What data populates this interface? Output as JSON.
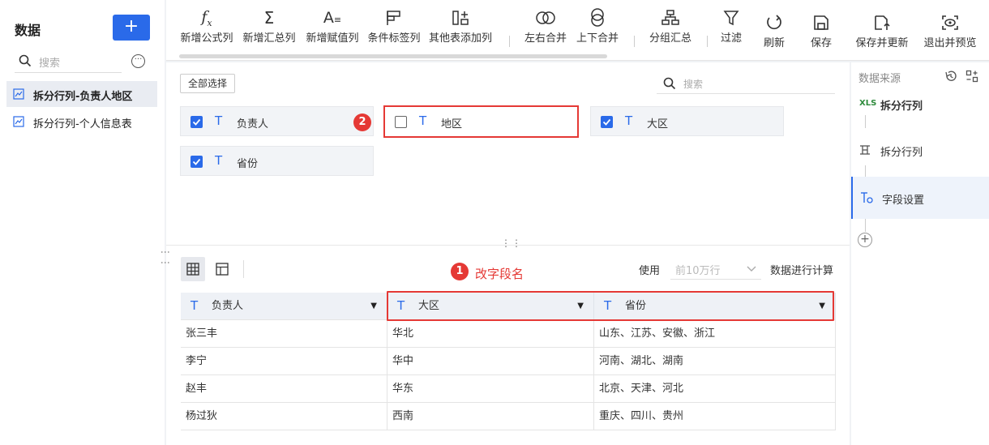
{
  "sidebar": {
    "title": "数据",
    "add_label": "+",
    "search_placeholder": "搜索",
    "tables": [
      {
        "label": "拆分行列-负责人地区",
        "active": true
      },
      {
        "label": "拆分行列-个人信息表",
        "active": false
      }
    ]
  },
  "toolbar": {
    "items": [
      {
        "label": "新增公式列",
        "icon": "formula-icon"
      },
      {
        "label": "新增汇总列",
        "icon": "sum-icon"
      },
      {
        "label": "新增赋值列",
        "icon": "assign-icon"
      },
      {
        "label": "条件标签列",
        "icon": "flag-icon"
      },
      {
        "label": "其他表添加列",
        "icon": "add-column-icon"
      },
      {
        "label": "左右合并",
        "icon": "merge-lr-icon"
      },
      {
        "label": "上下合并",
        "icon": "merge-tb-icon"
      },
      {
        "label": "分组汇总",
        "icon": "group-icon"
      },
      {
        "label": "过滤",
        "icon": "filter-icon"
      }
    ],
    "actions": [
      {
        "label": "刷新",
        "icon": "refresh-icon"
      },
      {
        "label": "保存",
        "icon": "save-icon"
      },
      {
        "label": "保存并更新",
        "icon": "save-update-icon"
      },
      {
        "label": "退出并预览",
        "icon": "preview-icon"
      }
    ]
  },
  "fields": {
    "select_all": "全部选择",
    "search_placeholder": "搜索",
    "items": [
      {
        "name": "负责人",
        "checked": true
      },
      {
        "name": "地区",
        "checked": false
      },
      {
        "name": "大区",
        "checked": true
      },
      {
        "name": "省份",
        "checked": true
      }
    ],
    "badge": "2",
    "type_glyph": "T"
  },
  "preview": {
    "annotation_badge": "1",
    "annotation": "改字段名",
    "use_label": "使用",
    "rows_option": "前10万行",
    "calc_label": "数据进行计算",
    "columns": [
      "负责人",
      "大区",
      "省份"
    ],
    "rows": [
      [
        "张三丰",
        "华北",
        "山东、江苏、安徽、浙江"
      ],
      [
        "李宁",
        "华中",
        "河南、湖北、湖南"
      ],
      [
        "赵丰",
        "华东",
        "北京、天津、河北"
      ],
      [
        "杨过狄",
        "西南",
        "重庆、四川、贵州"
      ]
    ]
  },
  "steps_panel": {
    "title": "数据来源",
    "steps": [
      {
        "label": "拆分行列",
        "icon": "xls-icon",
        "badge_text": "XLS"
      },
      {
        "label": "拆分行列",
        "icon": "split-icon"
      },
      {
        "label": "字段设置",
        "icon": "field-settings-icon"
      }
    ],
    "add_label": "+"
  },
  "colors": {
    "accent": "#2a6ae9",
    "highlight": "#e53935"
  }
}
